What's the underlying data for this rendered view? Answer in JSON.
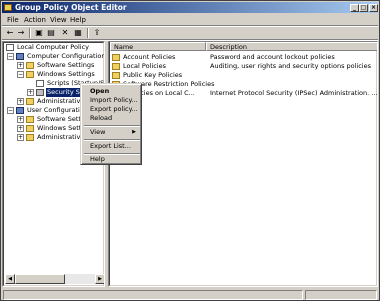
{
  "window": {
    "title": "Group Policy Object Editor",
    "controls": {
      "minimize": "_",
      "maximize": "□",
      "close": "×"
    }
  },
  "menubar": {
    "items": [
      "File",
      "Action",
      "View",
      "Help"
    ]
  },
  "toolbar": {
    "buttons": [
      {
        "icon": "back-arrow-icon",
        "glyph": "←"
      },
      {
        "icon": "forward-arrow-icon",
        "glyph": "→"
      },
      {
        "icon": "up-folder-icon",
        "glyph": "▣"
      },
      {
        "icon": "show-hide-tree-icon",
        "glyph": "▤"
      },
      {
        "icon": "delete-icon",
        "glyph": "✕"
      },
      {
        "icon": "properties-icon",
        "glyph": "▦"
      },
      {
        "icon": "export-list-icon",
        "glyph": "⇪"
      }
    ]
  },
  "tree": {
    "items": [
      {
        "label": "Local Computer Policy",
        "icon": "policy-icon",
        "expander": ""
      },
      {
        "label": "Computer Configuration",
        "icon": "computer-icon",
        "expander": "−"
      },
      {
        "label": "Software Settings",
        "icon": "folder-icon",
        "expander": "+"
      },
      {
        "label": "Windows Settings",
        "icon": "folder-icon",
        "expander": "−"
      },
      {
        "label": "Scripts (Startup/Shutdo",
        "icon": "script-icon",
        "expander": ""
      },
      {
        "label": "Security Setti",
        "icon": "security-icon",
        "expander": "+"
      },
      {
        "label": "Administrative Te",
        "icon": "folder-icon",
        "expander": "+"
      },
      {
        "label": "User Configuration",
        "icon": "user-icon",
        "expander": "−"
      },
      {
        "label": "Software Setti",
        "icon": "folder-icon",
        "expander": "+"
      },
      {
        "label": "Windows Settin",
        "icon": "folder-icon",
        "expander": "+"
      },
      {
        "label": "Administrative Te",
        "icon": "folder-icon",
        "expander": "+"
      }
    ]
  },
  "list": {
    "columns": [
      "Name",
      "Description"
    ],
    "rows": [
      {
        "name": "Account Policies",
        "desc": "Password and account lockout policies",
        "icon": "folder-icon"
      },
      {
        "name": "Local Policies",
        "desc": "Auditing, user rights and security options policies",
        "icon": "folder-icon"
      },
      {
        "name": "Public Key Policies",
        "desc": "",
        "icon": "folder-icon"
      },
      {
        "name": "Software Restriction Policies",
        "desc": "",
        "icon": "folder-icon"
      },
      {
        "name": "y Policies on Local C...",
        "desc": "Internet Protocol Security (IPSec) Administration. ...",
        "icon": "shield-icon"
      }
    ]
  },
  "context_menu": {
    "items": [
      {
        "label": "Open",
        "bold": true
      },
      {
        "label": "Import Policy..."
      },
      {
        "label": "Export policy..."
      },
      {
        "label": "Reload"
      },
      {
        "sep": true
      },
      {
        "label": "View",
        "submenu": true,
        "arrow": "▶"
      },
      {
        "sep": true
      },
      {
        "label": "Export List..."
      },
      {
        "sep": true
      },
      {
        "label": "Help"
      }
    ]
  }
}
